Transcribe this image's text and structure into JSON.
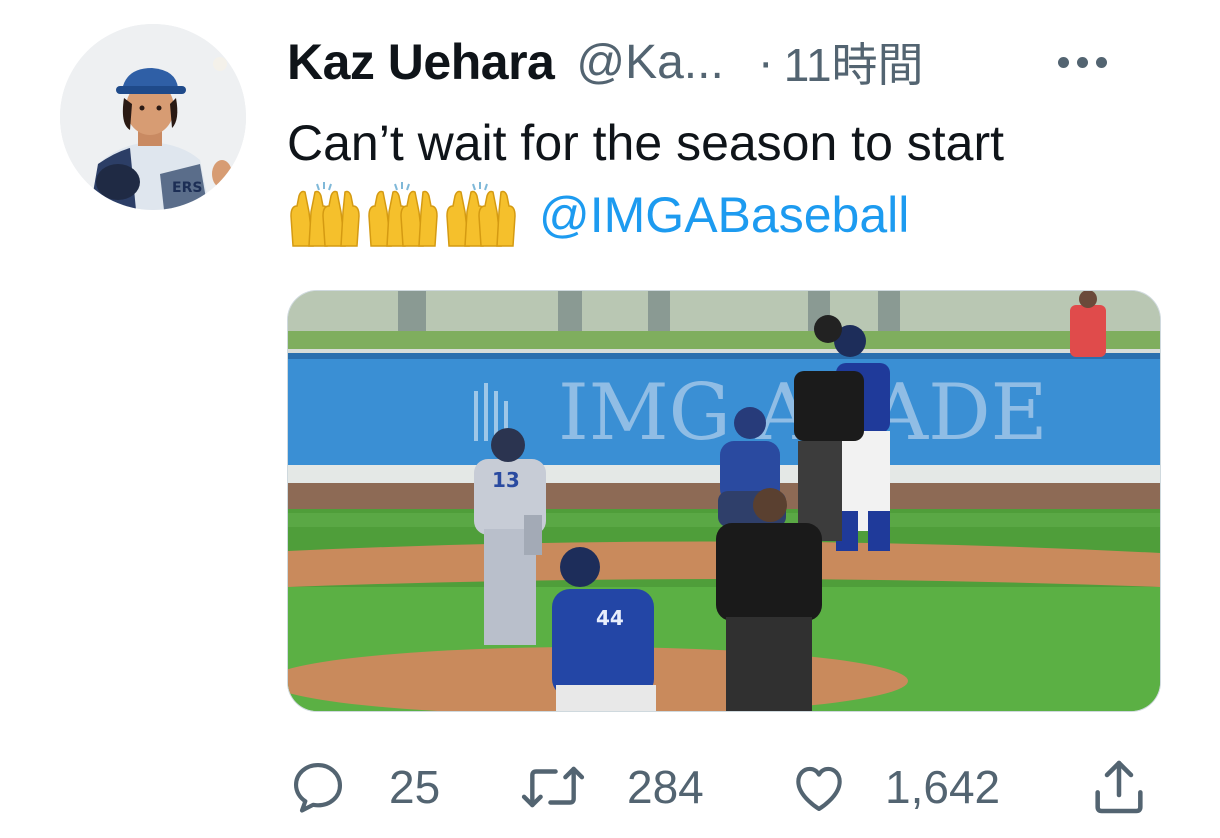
{
  "tweet": {
    "author_name": "Kaz Uehara",
    "author_handle": "@Ka...",
    "separator": "·",
    "timestamp": "11時間",
    "text_line1": "Can’t wait for the season to start",
    "mention": "@IMGABaseball",
    "emoji_icon": "raising-hands-icon",
    "emoji_count": 3,
    "media_banner_text": "IMG ACADE",
    "jersey_pitcher": "13",
    "jersey_fielder": "44"
  },
  "actions": {
    "reply_count": "25",
    "retweet_count": "284",
    "like_count": "1,642"
  },
  "colors": {
    "name_text": "#0f1419",
    "secondary_text": "#536471",
    "link": "#1d9bf0",
    "banner_blue": "#3a8fd4",
    "grass": "#4f9e3a",
    "dirt": "#c98a5c"
  }
}
